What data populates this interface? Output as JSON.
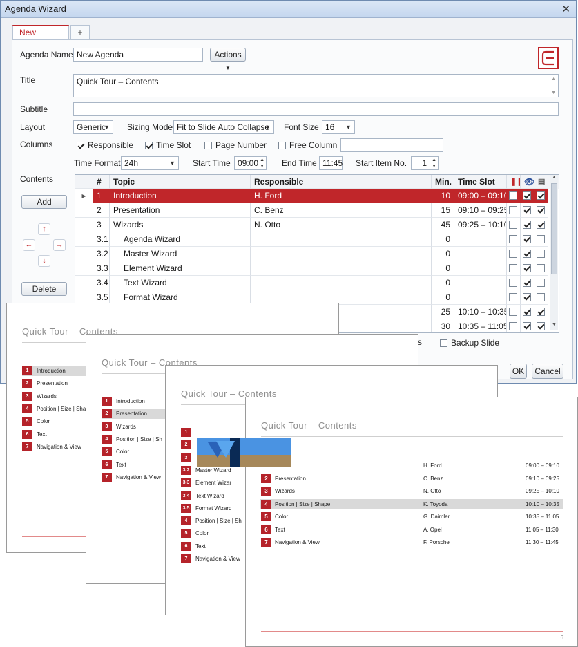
{
  "window": {
    "title": "Agenda Wizard",
    "close_glyph": "✕"
  },
  "tabs": [
    {
      "label": "New Agenda"
    },
    {
      "label": "+"
    }
  ],
  "form": {
    "agenda_name_label": "Agenda Name",
    "agenda_name_value": "New Agenda",
    "actions_label": "Actions",
    "title_label": "Title",
    "title_value": "Quick Tour – Contents",
    "subtitle_label": "Subtitle",
    "subtitle_value": "",
    "layout_label": "Layout",
    "layout_value": "Generic",
    "sizing_mode_label": "Sizing Mode",
    "sizing_mode_value": "Fit to Slide Auto Collapse",
    "font_size_label": "Font Size",
    "font_size_value": "16",
    "columns_label": "Columns",
    "col_responsible": "Responsible",
    "col_time_slot": "Time Slot",
    "col_page_number": "Page Number",
    "col_free_column": "Free Column",
    "free_column_value": "",
    "time_format_label": "Time Format",
    "time_format_value": "24h",
    "start_time_label": "Start Time",
    "start_time_value": "09:00",
    "end_time_label": "End Time",
    "end_time_value": "11:45",
    "start_item_label": "Start Item No.",
    "start_item_value": "1",
    "contents_label": "Contents",
    "add_label": "Add",
    "delete_label": "Delete",
    "backup_slide_label": "Backup Slide",
    "partial_label": "s",
    "ok_label": "OK",
    "cancel_label": "Cancel"
  },
  "grid": {
    "headers": {
      "num": "#",
      "topic": "Topic",
      "responsible": "Responsible",
      "min": "Min.",
      "time_slot": "Time Slot"
    },
    "rows": [
      {
        "num": "1",
        "topic": "Introduction",
        "responsible": "H. Ford",
        "min": "10",
        "slot": "09:00 – 09:10",
        "indent": false,
        "selected": true
      },
      {
        "num": "2",
        "topic": "Presentation",
        "responsible": "C. Benz",
        "min": "15",
        "slot": "09:10 – 09:25",
        "indent": false,
        "selected": false
      },
      {
        "num": "3",
        "topic": "Wizards",
        "responsible": "N. Otto",
        "min": "45",
        "slot": "09:25 – 10:10",
        "indent": false,
        "selected": false
      },
      {
        "num": "3.1",
        "topic": "Agenda Wizard",
        "responsible": "",
        "min": "0",
        "slot": "",
        "indent": true,
        "selected": false
      },
      {
        "num": "3.2",
        "topic": "Master Wizard",
        "responsible": "",
        "min": "0",
        "slot": "",
        "indent": true,
        "selected": false
      },
      {
        "num": "3.3",
        "topic": "Element Wizard",
        "responsible": "",
        "min": "0",
        "slot": "",
        "indent": true,
        "selected": false
      },
      {
        "num": "3.4",
        "topic": "Text Wizard",
        "responsible": "",
        "min": "0",
        "slot": "",
        "indent": true,
        "selected": false
      },
      {
        "num": "3.5",
        "topic": "Format Wizard",
        "responsible": "",
        "min": "0",
        "slot": "",
        "indent": true,
        "selected": false
      },
      {
        "num": "",
        "topic": "",
        "responsible": "",
        "min": "25",
        "slot": "10:10 – 10:35",
        "indent": false,
        "selected": false
      },
      {
        "num": "",
        "topic": "",
        "responsible": "",
        "min": "30",
        "slot": "10:35 – 11:05",
        "indent": false,
        "selected": false
      }
    ]
  },
  "slides": {
    "title": "Quick Tour – Contents",
    "page_number": "6",
    "slide1_items": [
      {
        "num": "1",
        "text": "Introduction"
      },
      {
        "num": "2",
        "text": "Presentation"
      },
      {
        "num": "3",
        "text": "Wizards"
      },
      {
        "num": "4",
        "text": "Position | Size | Sha"
      },
      {
        "num": "5",
        "text": "Color"
      },
      {
        "num": "6",
        "text": "Text"
      },
      {
        "num": "7",
        "text": "Navigation & View"
      }
    ],
    "slide2_items": [
      {
        "num": "1",
        "text": "Introduction"
      },
      {
        "num": "2",
        "text": "Presentation"
      },
      {
        "num": "3",
        "text": "Wizards"
      },
      {
        "num": "4",
        "text": "Position | Size | Sh"
      },
      {
        "num": "5",
        "text": "Color"
      },
      {
        "num": "6",
        "text": "Text"
      },
      {
        "num": "7",
        "text": "Navigation & View"
      }
    ],
    "slide3_items": [
      {
        "num": "1",
        "text": ""
      },
      {
        "num": "2",
        "text": ""
      },
      {
        "num": "3",
        "text": ""
      },
      {
        "num": "3.2",
        "text": "Master Wizard"
      },
      {
        "num": "3.3",
        "text": "Element Wizar"
      },
      {
        "num": "3.4",
        "text": "Text Wizard"
      },
      {
        "num": "3.5",
        "text": "Format Wizard"
      },
      {
        "num": "4",
        "text": "Position | Size | Sh"
      },
      {
        "num": "5",
        "text": "Color"
      },
      {
        "num": "6",
        "text": "Text"
      },
      {
        "num": "7",
        "text": "Navigation & View"
      }
    ],
    "slide4_rows": [
      {
        "num": "",
        "text": "on",
        "resp": "H. Ford",
        "slot": "09:00 – 09:10"
      },
      {
        "num": "2",
        "text": "Presentation",
        "resp": "C. Benz",
        "slot": "09:10 – 09:25"
      },
      {
        "num": "3",
        "text": "Wizards",
        "resp": "N. Otto",
        "slot": "09:25 – 10:10"
      },
      {
        "num": "4",
        "text": "Position | Size | Shape",
        "resp": "K. Toyoda",
        "slot": "10:10 – 10:35"
      },
      {
        "num": "5",
        "text": "Color",
        "resp": "G. Daimler",
        "slot": "10:35 – 11:05"
      },
      {
        "num": "6",
        "text": "Text",
        "resp": "A. Opel",
        "slot": "11:05 – 11:30"
      },
      {
        "num": "7",
        "text": "Navigation & View",
        "resp": "F. Porsche",
        "slot": "11:30 – 11:45"
      }
    ]
  },
  "colors": {
    "accent": "#c0262a",
    "selection": "#c0262a"
  }
}
